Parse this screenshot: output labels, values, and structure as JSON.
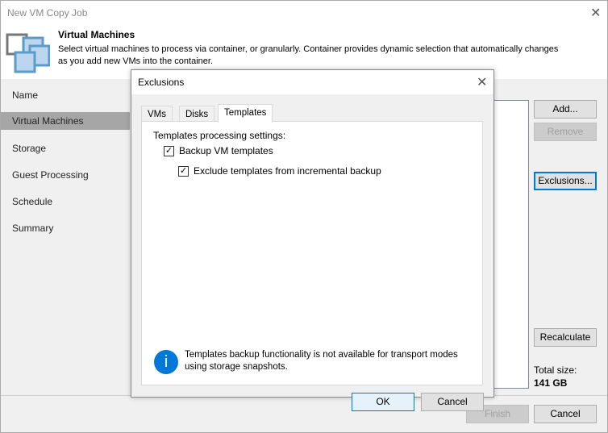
{
  "window": {
    "title": "New VM Copy Job"
  },
  "header": {
    "title": "Virtual Machines",
    "description_line1": "Select virtual machines to process via container, or granularly. Container provides dynamic selection that automatically changes",
    "description_line2": "as you add new VMs into the container."
  },
  "sidebar": {
    "items": [
      {
        "label": "Name"
      },
      {
        "label": "Virtual Machines"
      },
      {
        "label": "Storage"
      },
      {
        "label": "Guest Processing"
      },
      {
        "label": "Schedule"
      },
      {
        "label": "Summary"
      }
    ]
  },
  "buttons": {
    "add": "Add...",
    "remove": "Remove",
    "exclusions": "Exclusions...",
    "recalculate": "Recalculate",
    "finish": "Finish",
    "cancel": "Cancel"
  },
  "total": {
    "label": "Total size:",
    "value": "141 GB"
  },
  "dialog": {
    "title": "Exclusions",
    "tabs": [
      {
        "label": "VMs"
      },
      {
        "label": "Disks"
      },
      {
        "label": "Templates"
      }
    ],
    "section_label": "Templates processing settings:",
    "checkboxes": [
      {
        "label": "Backup VM templates",
        "checked": true
      },
      {
        "label": "Exclude templates from incremental backup",
        "checked": true
      }
    ],
    "info_line1": "Templates backup functionality is not available for transport modes",
    "info_line2": "using storage snapshots.",
    "ok": "OK",
    "cancel": "Cancel"
  }
}
